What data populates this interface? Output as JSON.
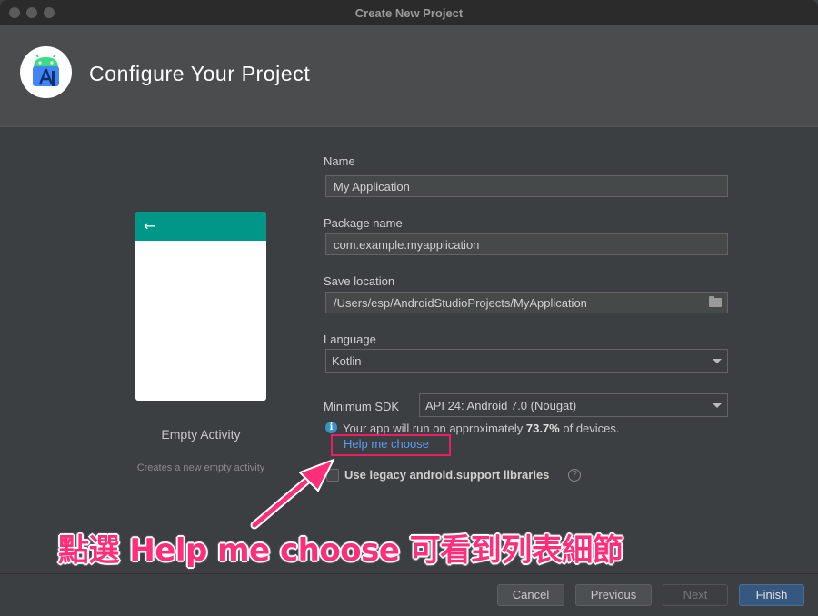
{
  "window": {
    "title": "Create New Project"
  },
  "header": {
    "title": "Configure Your Project",
    "logo_icon": "android-studio-icon"
  },
  "template": {
    "name": "Empty Activity",
    "description": "Creates a new empty activity",
    "back_icon": "arrow-left-icon"
  },
  "form": {
    "name": {
      "label": "Name",
      "value": "My Application"
    },
    "package": {
      "label": "Package name",
      "value": "com.example.myapplication"
    },
    "save_location": {
      "label": "Save location",
      "value": "/Users/esp/AndroidStudioProjects/MyApplication"
    },
    "language": {
      "label": "Language",
      "value": "Kotlin"
    },
    "min_sdk": {
      "label": "Minimum SDK",
      "value": "API 24: Android 7.0 (Nougat)"
    },
    "info": {
      "prefix": "Your app will run on approximately",
      "percent": "73.7%",
      "suffix": "of devices."
    },
    "help_link": "Help me choose",
    "legacy_checkbox": {
      "label": "Use legacy android.support libraries",
      "checked": false
    }
  },
  "annotation": {
    "text": "點選 Help me choose 可看到列表細節",
    "color": "#ff2e7a"
  },
  "footer": {
    "cancel": "Cancel",
    "previous": "Previous",
    "next": "Next",
    "finish": "Finish"
  }
}
